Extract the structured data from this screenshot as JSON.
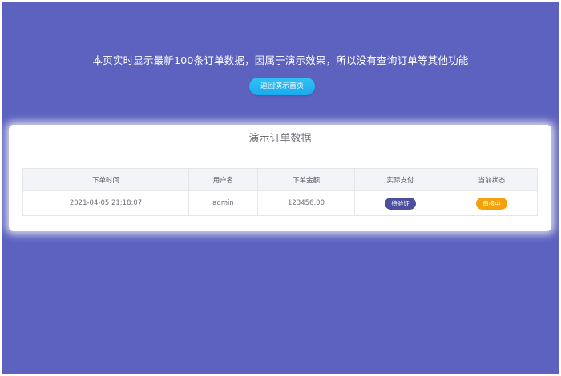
{
  "header": {
    "notice": "本页实时显示最新100条订单数据，因属于演示效果，所以没有查询订单等其他功能",
    "back_button_label": "返回演示首页"
  },
  "panel": {
    "title": "演示订单数据"
  },
  "table": {
    "columns": [
      "下单时间",
      "用户名",
      "下单金额",
      "实际支付",
      "当前状态"
    ],
    "rows": [
      {
        "time": "2021-04-05 21:18:07",
        "username": "admin",
        "amount": "123456.00",
        "payment": "待验证",
        "status": "审核中"
      }
    ]
  },
  "colors": {
    "background": "#5d62bf",
    "button": "#1aa9ec",
    "payment_badge": "#4b4f9c",
    "status_badge": "#f5a10b"
  }
}
